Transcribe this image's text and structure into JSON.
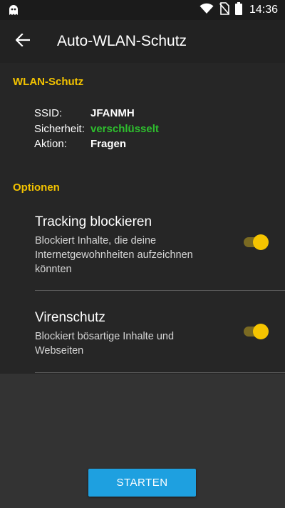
{
  "status_bar": {
    "time": "14:36",
    "icons": [
      "ghost-app-icon",
      "wifi-icon",
      "no-sim-icon",
      "battery-icon"
    ]
  },
  "app_bar": {
    "title": "Auto-WLAN-Schutz",
    "back_icon": "arrow-left-icon"
  },
  "wlan_section": {
    "header": "WLAN-Schutz",
    "rows": [
      {
        "label": "SSID:",
        "value": "JFANMH"
      },
      {
        "label": "Sicherheit:",
        "value": "verschlüsselt"
      },
      {
        "label": "Aktion:",
        "value": "Fragen"
      }
    ]
  },
  "options_section": {
    "header": "Optionen",
    "items": [
      {
        "title": "Tracking blockieren",
        "description": "Blockiert Inhalte, die deine Internetgewohnheiten aufzeichnen könnten",
        "enabled": true
      },
      {
        "title": "Virenschutz",
        "description": "Blockiert bösartige Inhalte und Webseiten",
        "enabled": true
      }
    ]
  },
  "start_button": {
    "label": "STARTEN"
  },
  "colors": {
    "accent": "#f2c200",
    "secure": "#2ec02e",
    "button": "#1ea0e0"
  }
}
